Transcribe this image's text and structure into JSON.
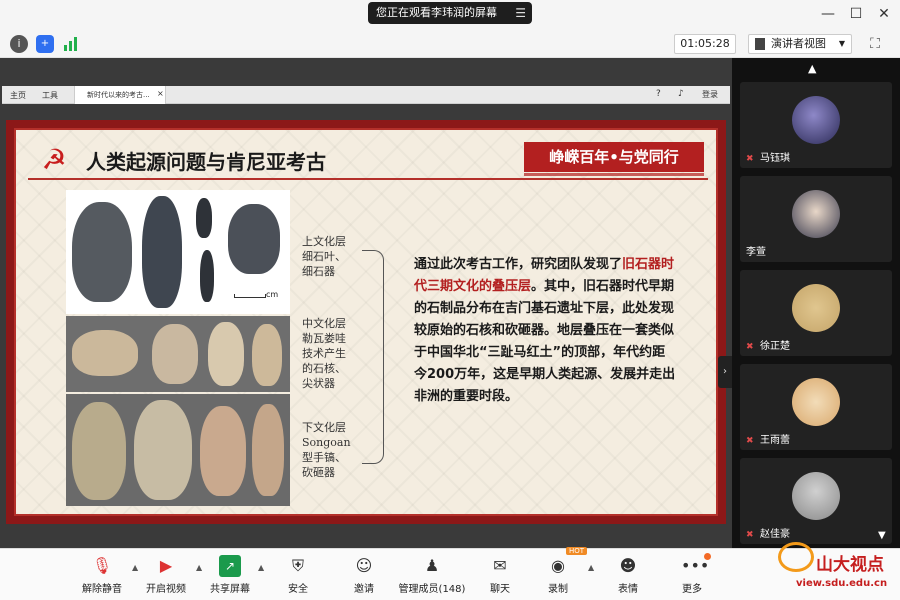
{
  "titlebar": {
    "share_notice": "您正在观看李玮润的屏幕",
    "menu_icon": "list-icon",
    "window_controls": [
      "minimize-icon",
      "maximize-icon",
      "close-icon"
    ]
  },
  "toolbar": {
    "info_icon": "info-icon",
    "shield_icon": "shield-icon",
    "signal_icon": "signal-bars-icon",
    "timer": "01:05:28",
    "view_mode": "演讲者视图",
    "fullscreen_icon": "fullscreen-icon"
  },
  "ppt": {
    "menu_home": "主页",
    "menu_tools": "工具",
    "tab_title": "新时代以来的考古...",
    "tab_close": "×",
    "login": "登录"
  },
  "slide": {
    "title": "人类起源问题与肯尼亚考古",
    "banner": "峥嵘百年•与党同行",
    "scale_label": "cm",
    "layers": [
      "上文化层\n细石叶、\n细石器",
      "中文化层\n勒瓦娄哇\n技术产生\n的石核、\n尖状器",
      "下文化层\nSongoan\n型手镐、\n砍砸器"
    ],
    "desc_part1": "通过此次考古工作，研究团队发现了",
    "desc_highlight": "旧石器时代三期文化的叠压层",
    "desc_part2": "。其中，旧石器时代早期的石制品分布在吉门基石遗址下层，此处发现较原始的石核和砍砸器。地层叠压在一套类似于中国华北“三趾马红土”的顶部，年代约距今200万年，这是早期人类起源、发展并走出非洲的重要时段。",
    "colors": {
      "frame": "#8c1818",
      "accent": "#b32020",
      "paper": "#f4ede0"
    }
  },
  "participants": [
    {
      "name": "马钰琪",
      "muted": true
    },
    {
      "name": "李萱",
      "muted": false
    },
    {
      "name": "徐正楚",
      "muted": true
    },
    {
      "name": "王雨蕾",
      "muted": true
    },
    {
      "name": "赵佳豪",
      "muted": true
    }
  ],
  "bottombar": {
    "items": [
      {
        "label": "解除静音",
        "icon": "mic-off-icon"
      },
      {
        "label": "开启视频",
        "icon": "video-off-icon"
      },
      {
        "label": "共享屏幕",
        "icon": "share-screen-icon"
      },
      {
        "label": "安全",
        "icon": "security-icon"
      },
      {
        "label": "邀请",
        "icon": "invite-icon"
      },
      {
        "label": "管理成员(148)",
        "icon": "members-icon"
      },
      {
        "label": "聊天",
        "icon": "chat-icon"
      },
      {
        "label": "录制",
        "icon": "record-icon"
      },
      {
        "label": "表情",
        "icon": "emoji-icon"
      },
      {
        "label": "更多",
        "icon": "more-icon"
      }
    ],
    "record_badge": "HOT"
  },
  "watermark": {
    "name": "山大视点",
    "url": "view.sdu.edu.cn"
  }
}
